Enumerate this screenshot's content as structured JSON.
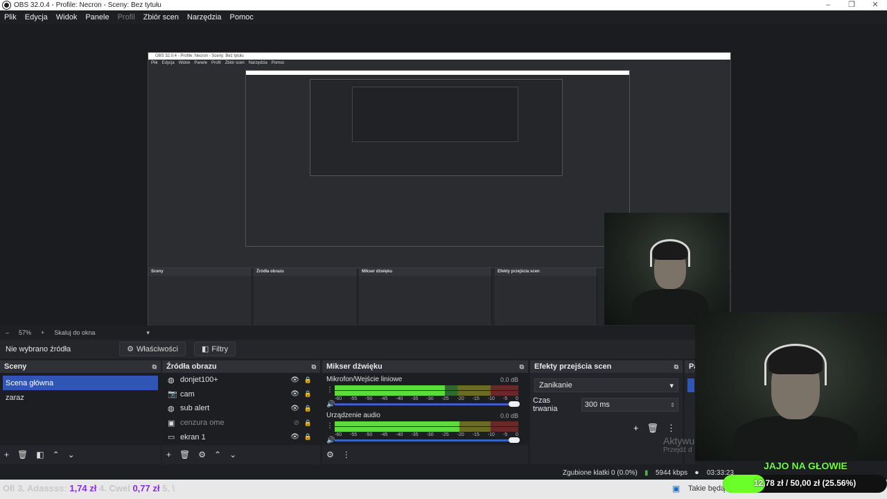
{
  "window": {
    "title": "OBS 32.0.4 - Profile: Necron - Sceny: Bez tytułu",
    "controls": [
      "–",
      "❐",
      "✕"
    ]
  },
  "menu": [
    "Plik",
    "Edycja",
    "Widok",
    "Panele",
    "Profil",
    "Zbiór scen",
    "Narzędzia",
    "Pomoc"
  ],
  "nested_menu": [
    "Plik",
    "Edycja",
    "Widok",
    "Panele",
    "Profil",
    "Zbiór scen",
    "Narzędzia",
    "Pomoc"
  ],
  "zoom": {
    "minus": "–",
    "value": "57%",
    "plus": "+",
    "mode": "Skaluj do okna"
  },
  "sourcebar": {
    "no_source": "Nie wybrano źródła",
    "properties": "Właściwości",
    "filters": "Filtry"
  },
  "scenes": {
    "title": "Sceny",
    "items": [
      "Scena główna",
      "zaraz"
    ]
  },
  "sources": {
    "title": "Źródła obrazu",
    "items": [
      {
        "label": "donjet100+",
        "icon": "globe-icon"
      },
      {
        "label": "cam",
        "icon": "camera-icon"
      },
      {
        "label": "sub alert",
        "icon": "globe-icon"
      },
      {
        "label": "cenzura ome",
        "icon": "image-icon"
      },
      {
        "label": "ekran 1",
        "icon": "monitor-icon"
      }
    ]
  },
  "mixer": {
    "title": "Mikser dźwięku",
    "tracks": [
      {
        "name": "Mikrofon/Wejście liniowe",
        "db": "0.0 dB",
        "level": 0.6
      },
      {
        "name": "Urządzenie audio",
        "db": "0.0 dB",
        "level": 0.68
      }
    ],
    "ticks": [
      "-60",
      "-55",
      "-50",
      "-45",
      "-40",
      "-35",
      "-30",
      "-25",
      "-20",
      "-15",
      "-10",
      "-5",
      "0"
    ]
  },
  "transitions": {
    "title": "Efekty przejścia scen",
    "selected": "Zanikanie",
    "duration_label": "Czas trwania",
    "duration_value": "300 ms"
  },
  "controls_panel_title": "Pa",
  "activate": {
    "line1": "Aktywu",
    "line2": "Przejdź d"
  },
  "status": {
    "dropped": "Zgubione klatki 0 (0.0%)",
    "bitrate": "5944 kbps",
    "time": "03:33:23"
  },
  "ticker": {
    "prefix": "Ołl 3. Adassss:",
    "amount1": "1,74 zł",
    "mid": "4. Cwel",
    "amount2": "0,77 zł",
    "suffix": "5. \\"
  },
  "taskbar": {
    "weather": "Takie będą"
  },
  "overlay": {
    "title": "JAJO NA GŁOWIE",
    "goal_text": "12,78 zł / 50,00 zł (25.56%)",
    "progress": 0.2556
  },
  "colors": {
    "accent": "#2f55b5",
    "overlay_green": "#6aff28",
    "meter_green": "#5bdc3a"
  }
}
